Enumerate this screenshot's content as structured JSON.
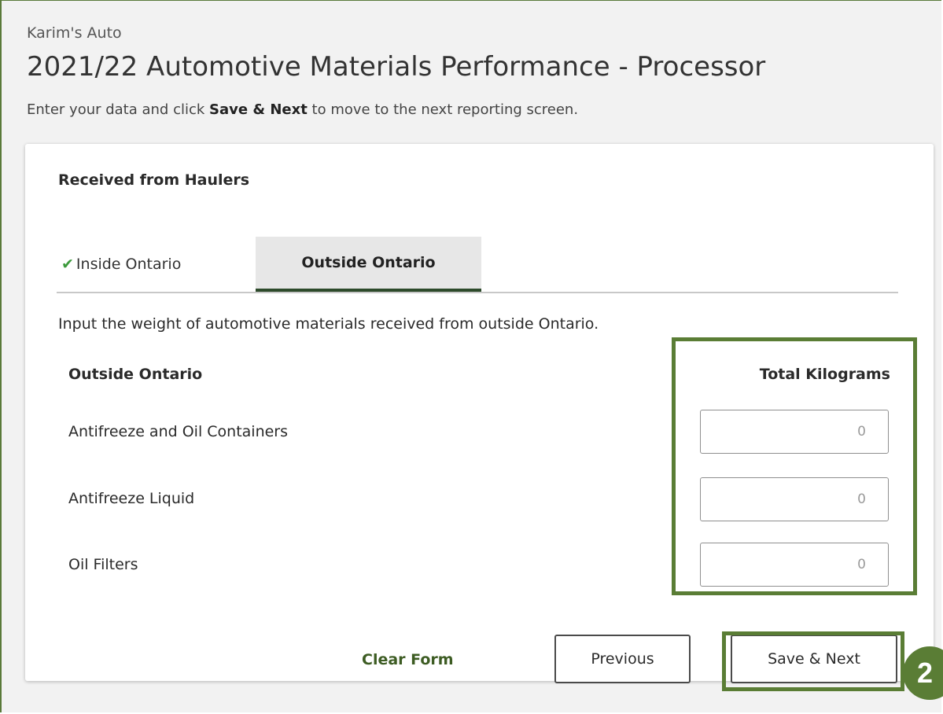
{
  "header": {
    "company": "Karim's Auto",
    "title": "2021/22 Automotive Materials Performance - Processor",
    "instructions": {
      "before": "Enter your data and click ",
      "bold": "Save & Next",
      "after": " to move to the next reporting screen."
    }
  },
  "card": {
    "section_title": "Received from Haulers",
    "tabs": [
      {
        "label": "Inside Ontario",
        "icon": "check-icon",
        "completed": true
      },
      {
        "label": "Outside Ontario",
        "active": true
      }
    ],
    "description": "Input the weight of automotive materials received from outside Ontario.",
    "column_left": "Outside Ontario",
    "column_right": "Total Kilograms",
    "rows": [
      {
        "label": "Antifreeze and Oil Containers",
        "placeholder": "0"
      },
      {
        "label": "Antifreeze Liquid",
        "placeholder": "0"
      },
      {
        "label": "Oil Filters",
        "placeholder": "0"
      }
    ],
    "actions": {
      "clear": "Clear Form",
      "previous": "Previous",
      "next": "Save & Next"
    }
  },
  "annotation": {
    "step_number": "2",
    "highlight_color": "#5a7d35"
  }
}
